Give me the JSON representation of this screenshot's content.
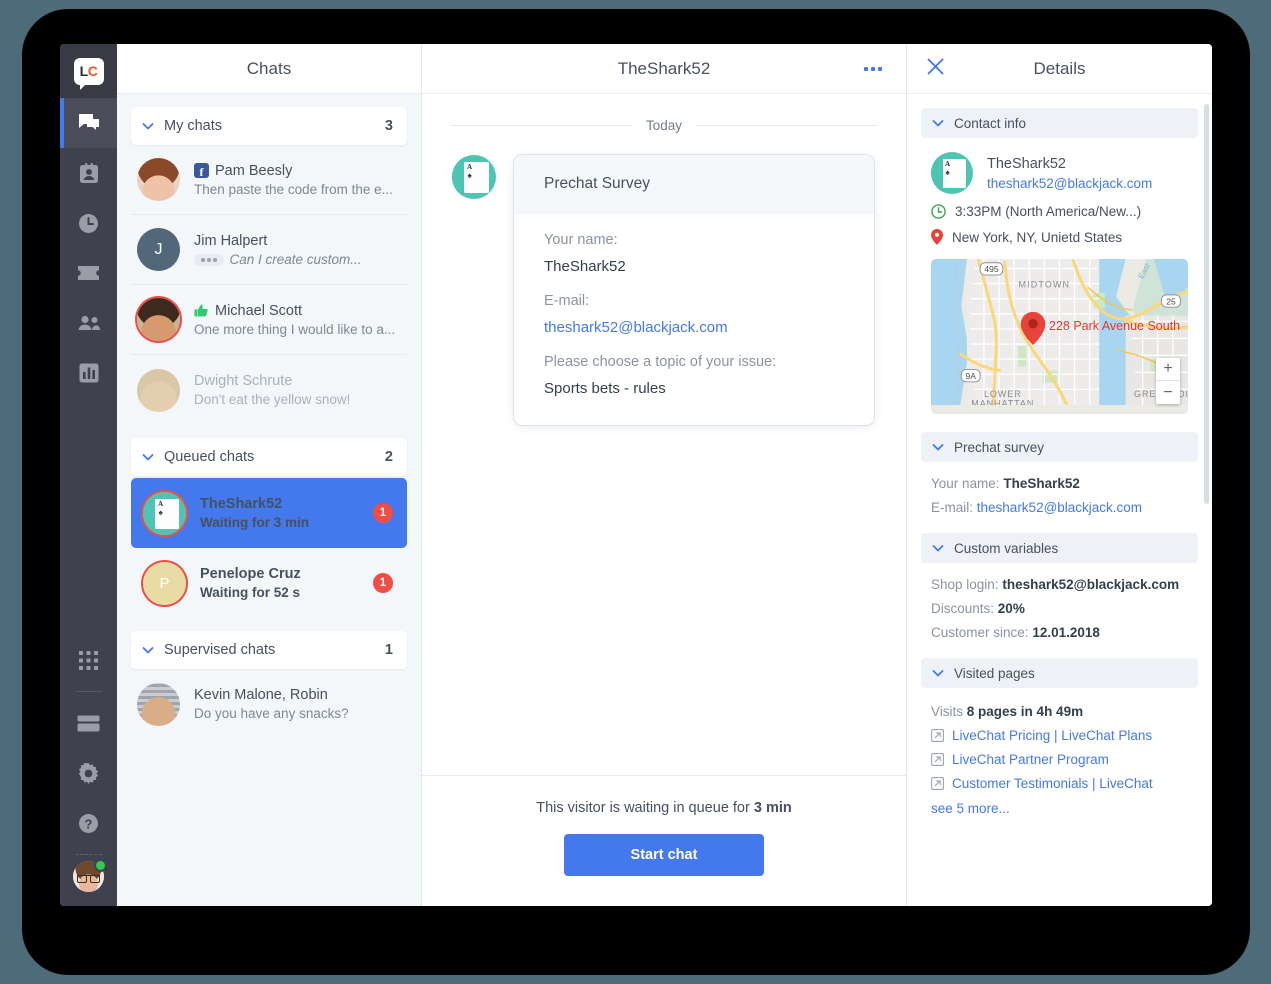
{
  "brand": {
    "logo_text_left": "L",
    "logo_text_right": "C",
    "accent": "#4379ec",
    "danger": "#ef4d45",
    "teal": "#4ec4b4"
  },
  "rail": {
    "items": [
      {
        "name": "chats",
        "icon": "chat-icon",
        "active": true
      },
      {
        "name": "visitors",
        "icon": "contact-card-icon",
        "active": false
      },
      {
        "name": "history",
        "icon": "clock-icon",
        "active": false
      },
      {
        "name": "tickets",
        "icon": "ticket-icon",
        "active": false
      },
      {
        "name": "team",
        "icon": "people-icon",
        "active": false
      },
      {
        "name": "reports",
        "icon": "bar-chart-icon",
        "active": false
      }
    ],
    "bottom_items": [
      {
        "name": "apps",
        "icon": "apps-grid-icon"
      },
      {
        "name": "archives",
        "icon": "archive-icon"
      },
      {
        "name": "settings",
        "icon": "gear-icon"
      },
      {
        "name": "help",
        "icon": "question-mark-icon"
      }
    ],
    "agent_status": "online"
  },
  "chats": {
    "header": "Chats",
    "groups": [
      {
        "label": "My chats",
        "count": "3",
        "rows": [
          {
            "name": "Pam Beesly",
            "preview": "Then paste the code from the e...",
            "channel_icon": "facebook-icon",
            "avatar": "photo-pam",
            "dim": false,
            "ring": false,
            "typing": false
          },
          {
            "name": "Jim Halpert",
            "preview": "Can I create custom...",
            "channel_icon": "",
            "avatar": "initial-J",
            "dim": false,
            "ring": false,
            "typing": true
          },
          {
            "name": "Michael Scott",
            "preview": "One more thing I would like to a...",
            "channel_icon": "thumbs-up-icon",
            "avatar": "photo-michael",
            "dim": false,
            "ring": true,
            "typing": false
          },
          {
            "name": "Dwight Schrute",
            "preview": "Don't eat the yellow snow!",
            "channel_icon": "",
            "avatar": "photo-dwight",
            "dim": true,
            "ring": false,
            "typing": false
          }
        ]
      },
      {
        "label": "Queued chats",
        "count": "2",
        "rows": [
          {
            "name": "TheShark52",
            "preview": "Waiting for 3 min",
            "channel_icon": "",
            "avatar": "card-ace",
            "selected": true,
            "ring": true,
            "badge": "1"
          },
          {
            "name": "Penelope Cruz",
            "preview": "Waiting for 52 s",
            "channel_icon": "",
            "avatar": "initial-P",
            "selected": false,
            "ring": true,
            "badge": "1"
          }
        ]
      },
      {
        "label": "Supervised chats",
        "count": "1",
        "rows": [
          {
            "name": "Kevin Malone, Robin",
            "preview": "Do you have any snacks?",
            "channel_icon": "",
            "avatar": "photo-kevin",
            "dim": false,
            "ring": false,
            "typing": false
          }
        ]
      }
    ]
  },
  "conversation": {
    "title": "TheShark52",
    "menu_icon": "more-options-icon",
    "day_label": "Today",
    "survey": {
      "heading": "Prechat Survey",
      "fields": [
        {
          "question": "Your name:",
          "answer": "TheShark52",
          "is_link": false
        },
        {
          "question": "E-mail:",
          "answer": "theshark52@blackjack.com",
          "is_link": true
        },
        {
          "question": "Please choose a topic of your issue:",
          "answer": "Sports bets - rules",
          "is_link": false
        }
      ]
    },
    "footer": {
      "wait_prefix": "This visitor is waiting in queue for ",
      "wait_value": "3 min",
      "start_button": "Start chat"
    }
  },
  "details": {
    "header": "Details",
    "close_icon": "close-icon",
    "sections": {
      "contact_info": {
        "label": "Contact info",
        "name": "TheShark52",
        "email": "theshark52@blackjack.com",
        "time": "3:33PM (North America/New...)",
        "time_icon": "clock-icon",
        "location": "New York, NY, Unietd States",
        "location_icon": "map-pin-icon"
      },
      "map": {
        "address_label": "228 Park Avenue South",
        "pin_icon": "map-pin-icon",
        "zoom_in": "+",
        "zoom_out": "−",
        "labels": [
          "495",
          "MIDTOWN",
          "25",
          "9A",
          "LOWER MANHATTAN",
          "GREENPOI",
          "East"
        ]
      },
      "prechat_survey": {
        "label": "Prechat survey",
        "rows": [
          {
            "key": "Your name:",
            "value": "TheShark52",
            "is_link": false
          },
          {
            "key": "E-mail:",
            "value": "theshark52@blackjack.com",
            "is_link": true
          }
        ]
      },
      "custom_variables": {
        "label": "Custom variables",
        "rows": [
          {
            "key": "Shop login:",
            "value": "theshark52@blackjack.com"
          },
          {
            "key": "Discounts:",
            "value": "20%"
          },
          {
            "key": "Customer since:",
            "value": "12.01.2018"
          }
        ]
      },
      "visited_pages": {
        "label": "Visited pages",
        "visits_key": "Visits",
        "visits_value": "8 pages in 4h 49m",
        "pages": [
          "LiveChat Pricing | LiveChat Plans",
          "LiveChat Partner Program",
          "Customer Testimonials | LiveChat"
        ],
        "see_more": "see 5 more...",
        "link_icon": "external-link-icon"
      }
    }
  }
}
